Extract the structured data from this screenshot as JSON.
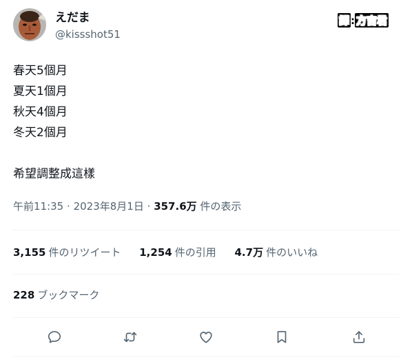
{
  "user": {
    "display_name": "えだま",
    "handle": "@kissshot51"
  },
  "watermark": {
    "prefix": "譯",
    "sep": ":",
    "name": "方吉君"
  },
  "tweet": {
    "lines": [
      "春天5個月",
      "夏天1個月",
      "秋天4個月",
      "冬天2個月",
      "",
      "希望調整成這樣"
    ]
  },
  "meta": {
    "time": "午前11:35",
    "dot1": "·",
    "date": "2023年8月1日",
    "dot2": "·",
    "views": "357.6万",
    "views_label": "件の表示"
  },
  "stats": {
    "retweets": "3,155",
    "retweets_label": "件のリツイート",
    "quotes": "1,254",
    "quotes_label": "件の引用",
    "likes": "4.7万",
    "likes_label": "件のいいね"
  },
  "bookmarks": {
    "count": "228",
    "label": "ブックマーク"
  },
  "actions": {
    "icons": [
      "reply-icon",
      "retweet-icon",
      "like-icon",
      "bookmark-icon",
      "share-icon"
    ]
  },
  "colors": {
    "text": "#0f1419",
    "secondary": "#536471",
    "divider": "#eff3f4"
  }
}
